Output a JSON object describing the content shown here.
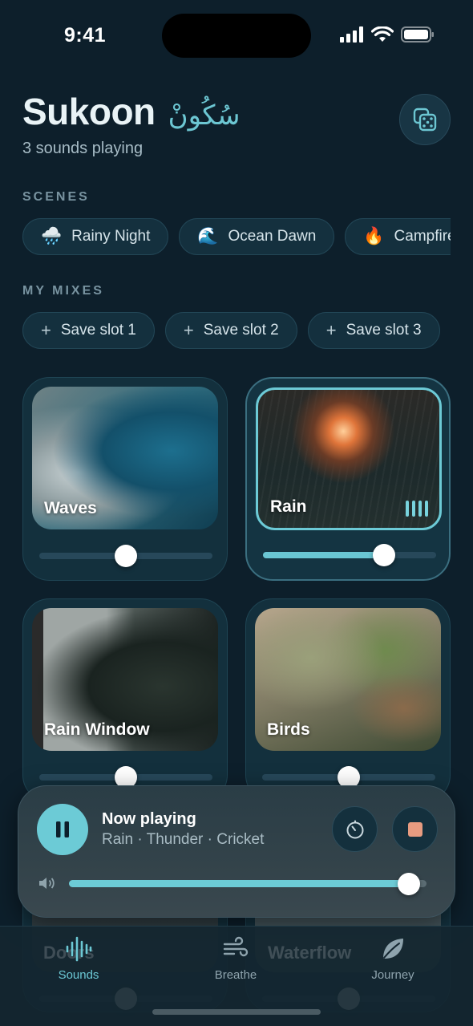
{
  "status": {
    "time": "9:41"
  },
  "header": {
    "title": "Sukoon",
    "title_urdu": "سُکُونْ",
    "subtitle": "3 sounds playing",
    "dice_icon": "dice-icon"
  },
  "scenes": {
    "label": "SCENES",
    "items": [
      {
        "emoji": "🌧️",
        "label": "Rainy Night"
      },
      {
        "emoji": "🌊",
        "label": "Ocean Dawn"
      },
      {
        "emoji": "🔥",
        "label": "Campfire"
      }
    ]
  },
  "mixes": {
    "label": "MY MIXES",
    "items": [
      {
        "label": "Save slot 1"
      },
      {
        "label": "Save slot 2"
      },
      {
        "label": "Save slot 3"
      }
    ]
  },
  "sounds": [
    {
      "name": "Waves",
      "active": false,
      "volume": 0.5
    },
    {
      "name": "Rain",
      "active": true,
      "volume": 0.7
    },
    {
      "name": "Rain Window",
      "active": false,
      "volume": 0.5
    },
    {
      "name": "Birds",
      "active": false,
      "volume": 0.5
    },
    {
      "name": "Doors",
      "active": false,
      "volume": 0.5
    },
    {
      "name": "Waterflow",
      "active": false,
      "volume": 0.5
    }
  ],
  "player": {
    "title": "Now playing",
    "tracks": "Rain · Thunder · Cricket",
    "volume": 0.95
  },
  "tabs": [
    {
      "label": "Sounds",
      "active": true,
      "icon": "waveform-icon"
    },
    {
      "label": "Breathe",
      "active": false,
      "icon": "wind-icon"
    },
    {
      "label": "Journey",
      "active": false,
      "icon": "leaf-icon"
    }
  ],
  "colors": {
    "accent": "#6ccbd6",
    "background": "#0d1f2b",
    "stop": "#e79b80"
  }
}
